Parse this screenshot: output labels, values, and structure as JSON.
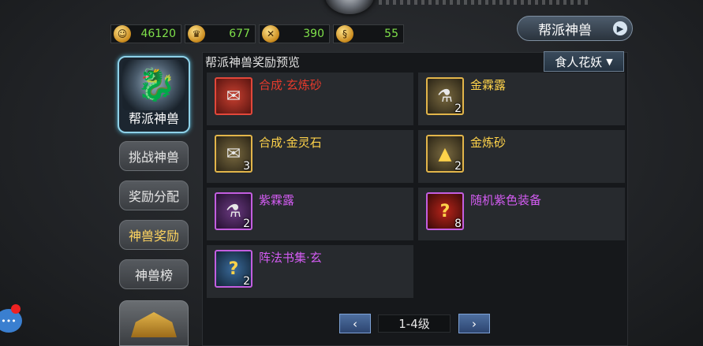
{
  "currency": [
    {
      "icon": "gold-coin-icon",
      "glyph": "☺",
      "value": "46120"
    },
    {
      "icon": "guild-emblem-icon",
      "glyph": "♛",
      "value": "677"
    },
    {
      "icon": "crossed-swords-icon",
      "glyph": "✕",
      "value": "390"
    },
    {
      "icon": "scroll-token-icon",
      "glyph": "§",
      "value": "55"
    }
  ],
  "header": {
    "beast_button": "帮派神兽"
  },
  "sidebar": {
    "main_tab": "帮派神兽",
    "tabs": [
      {
        "label": "挑战神兽"
      },
      {
        "label": "奖励分配"
      },
      {
        "label": "神兽奖励"
      },
      {
        "label": "神兽榜"
      }
    ]
  },
  "panel": {
    "title": "帮派神兽奖励预览",
    "dropdown_value": "食人花妖",
    "dropdown_arrow": "▼"
  },
  "items": [
    {
      "name": "合成·玄炼砂",
      "count": "",
      "quality": "red",
      "glyph": "✉"
    },
    {
      "name": "金霖露",
      "count": "2",
      "quality": "gold",
      "glyph": "⚗"
    },
    {
      "name": "合成·金灵石",
      "count": "3",
      "quality": "gold",
      "glyph": "✉"
    },
    {
      "name": "金炼砂",
      "count": "2",
      "quality": "gold",
      "glyph": "▲"
    },
    {
      "name": "紫霖露",
      "count": "2",
      "quality": "purple",
      "glyph": "⚗"
    },
    {
      "name": "随机紫色装备",
      "count": "8",
      "quality": "purple",
      "glyph": "?"
    },
    {
      "name": "阵法书集·玄",
      "count": "2",
      "quality": "purple",
      "glyph": "?"
    }
  ],
  "pager": {
    "prev": "‹",
    "next": "›",
    "label": "1-4级"
  },
  "chat": {
    "glyph": "•••"
  }
}
